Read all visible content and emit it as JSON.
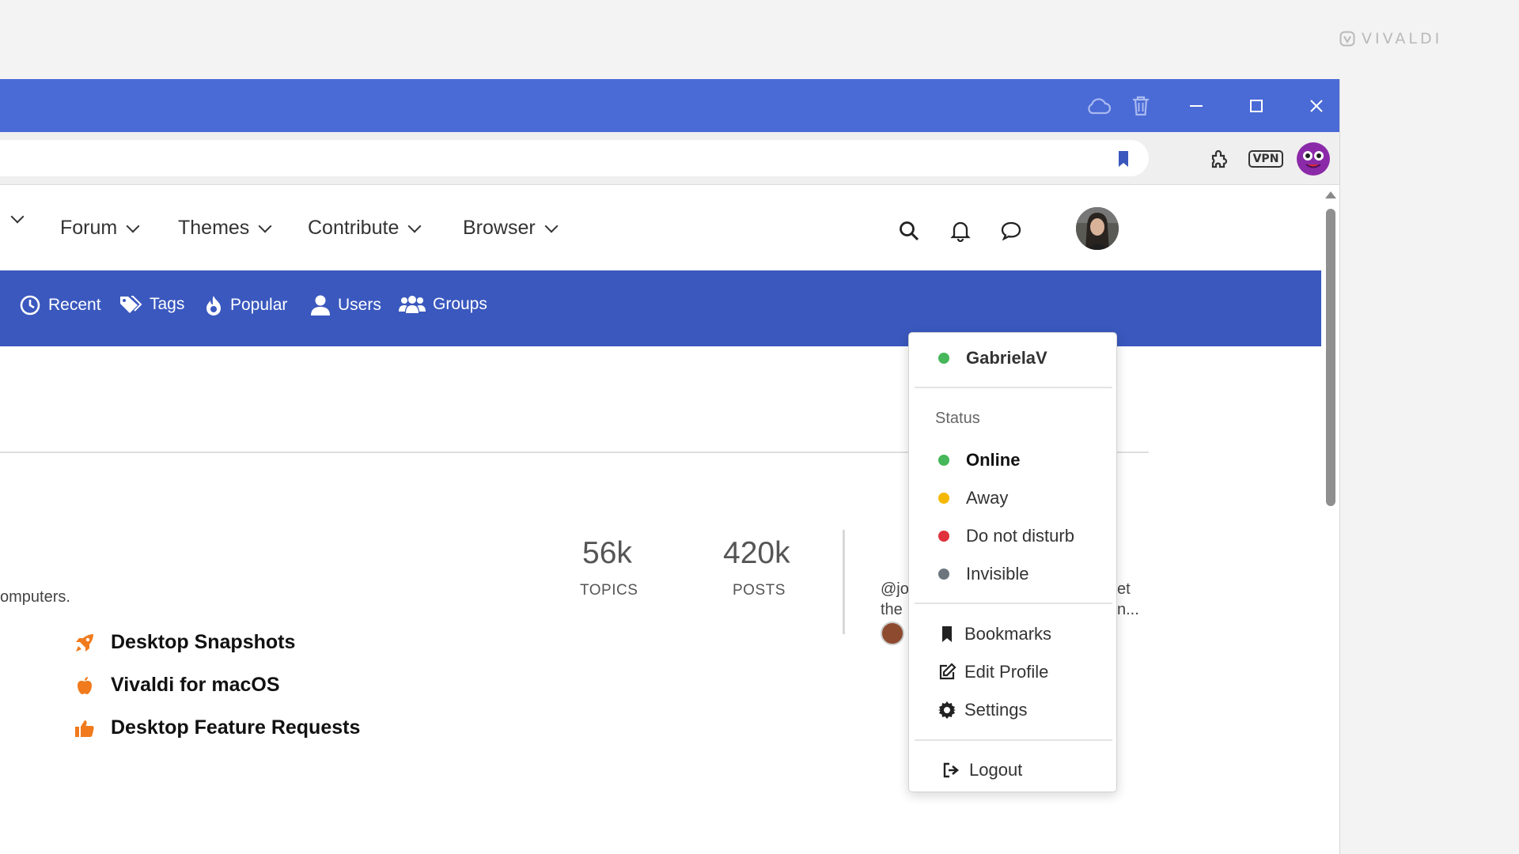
{
  "watermark": {
    "brand": "VIVALDI"
  },
  "colors": {
    "titlebar": "#4a6ad6",
    "bluebar": "#3a58be",
    "online": "#46b75a",
    "away": "#f5b800",
    "dnd": "#e0323c",
    "invisible": "#6c757d",
    "accent": "#f07a1c"
  },
  "titlebar": {
    "icons": [
      "cloud-sync-icon",
      "trash-icon",
      "minimize-icon",
      "maximize-icon",
      "close-icon"
    ]
  },
  "toolbar": {
    "vpn_label": "VPN",
    "icons": [
      "bookmark-icon",
      "extensions-icon",
      "vpn-icon",
      "profile-icon"
    ]
  },
  "nav": {
    "items": [
      {
        "label": "Forum"
      },
      {
        "label": "Themes"
      },
      {
        "label": "Contribute"
      },
      {
        "label": "Browser"
      }
    ],
    "icons": [
      "search-icon",
      "bell-icon",
      "chat-icon",
      "avatar"
    ]
  },
  "subnav": {
    "items": [
      {
        "label": "Recent",
        "icon": "clock-icon"
      },
      {
        "label": "Tags",
        "icon": "tags-icon"
      },
      {
        "label": "Popular",
        "icon": "fire-icon"
      },
      {
        "label": "Users",
        "icon": "user-icon"
      },
      {
        "label": "Groups",
        "icon": "groups-icon"
      }
    ]
  },
  "main": {
    "description_fragment": "omputers.",
    "stats": [
      {
        "value": "56k",
        "label": "TOPICS"
      },
      {
        "value": "420k",
        "label": "POSTS"
      }
    ],
    "last_post": {
      "line1": "@jo",
      "line2": "the",
      "right1": "et",
      "right2": "n..."
    },
    "subcategories": [
      {
        "label": "Desktop Snapshots",
        "icon": "rocket-icon"
      },
      {
        "label": "Vivaldi for macOS",
        "icon": "apple-icon"
      },
      {
        "label": "Desktop Feature Requests",
        "icon": "thumbs-up-icon"
      }
    ]
  },
  "dropdown": {
    "username": "GabrielaV",
    "status_header": "Status",
    "statuses": [
      {
        "label": "Online",
        "color": "#46b75a",
        "selected": true
      },
      {
        "label": "Away",
        "color": "#f5b800"
      },
      {
        "label": "Do not disturb",
        "color": "#e0323c"
      },
      {
        "label": "Invisible",
        "color": "#6c757d"
      }
    ],
    "links": [
      {
        "label": "Bookmarks",
        "icon": "bookmark-icon"
      },
      {
        "label": "Edit Profile",
        "icon": "edit-icon"
      },
      {
        "label": "Settings",
        "icon": "gear-icon"
      }
    ],
    "logout": {
      "label": "Logout",
      "icon": "logout-icon"
    }
  }
}
